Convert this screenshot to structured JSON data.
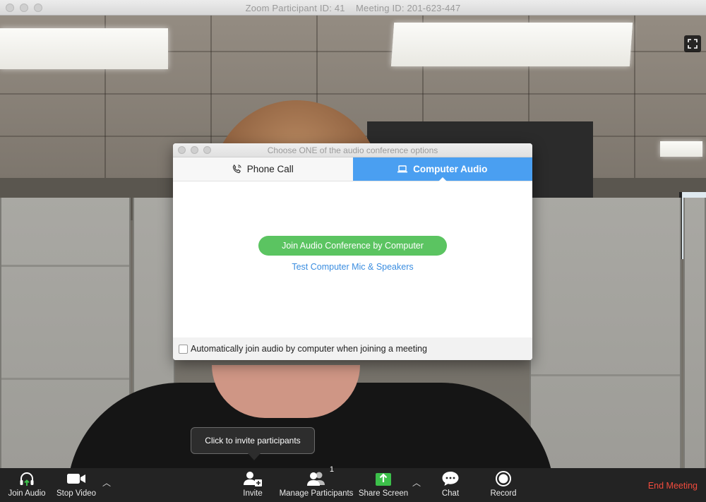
{
  "window": {
    "title": "Zoom Participant ID: 41    Meeting ID: 201-623-447"
  },
  "video": {
    "expand_icon": "expand-icon"
  },
  "dialog": {
    "title": "Choose ONE of the audio conference options",
    "tabs": [
      {
        "label": "Phone Call",
        "icon": "phone-icon",
        "active": false
      },
      {
        "label": "Computer Audio",
        "icon": "laptop-icon",
        "active": true
      }
    ],
    "join_button": "Join Audio Conference by Computer",
    "test_link": "Test Computer Mic & Speakers",
    "auto_join_label": "Automatically join audio by computer when joining a meeting",
    "auto_join_checked": false,
    "accent_color": "#4a9ff1",
    "join_color": "#5bc461"
  },
  "tooltip": {
    "text": "Click to invite participants"
  },
  "toolbar": {
    "join_audio": "Join Audio",
    "stop_video": "Stop Video",
    "invite": "Invite",
    "manage_participants": "Manage Participants",
    "participant_count": "1",
    "share_screen": "Share Screen",
    "chat": "Chat",
    "record": "Record",
    "end_meeting": "End Meeting",
    "end_color": "#f24b3d"
  }
}
